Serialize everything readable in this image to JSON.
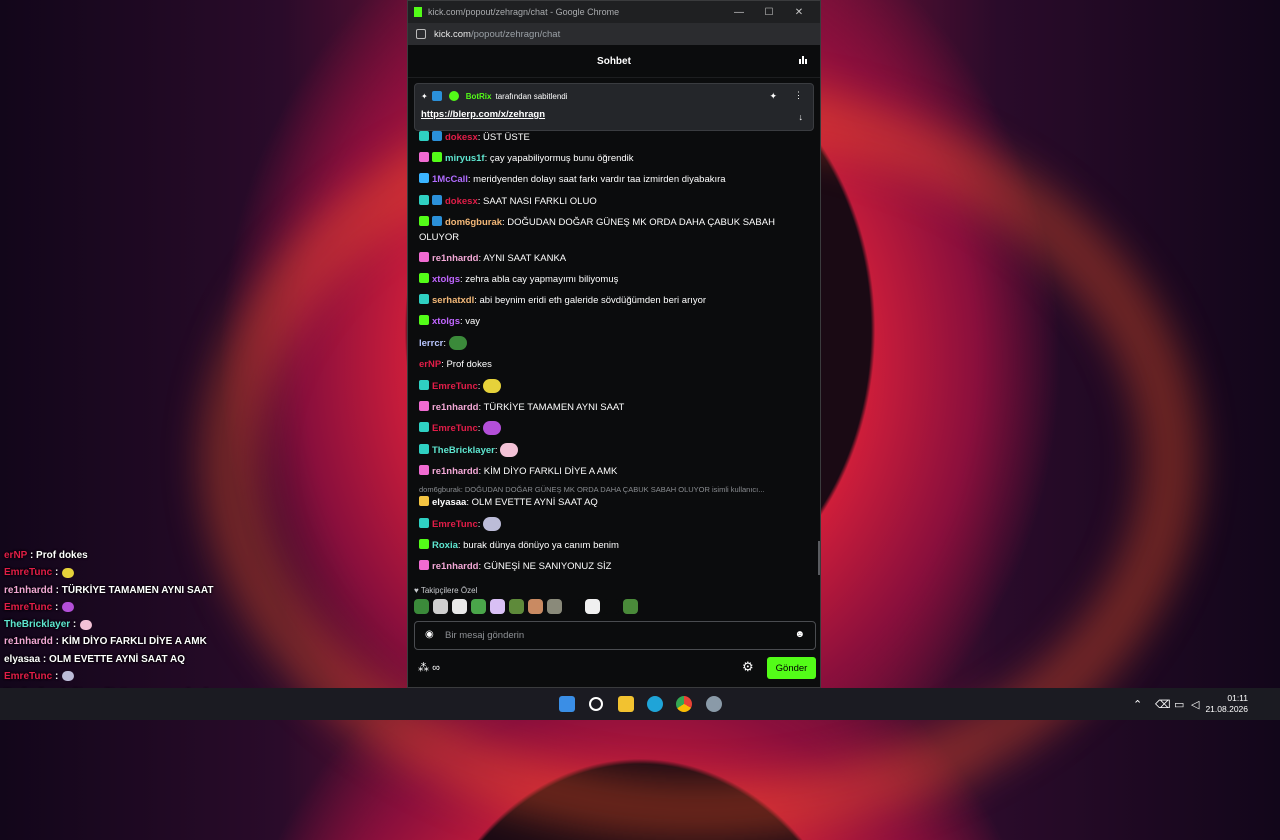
{
  "window": {
    "title": "kick.com/popout/zehragn/chat - Google Chrome",
    "url_host": "kick.com",
    "url_path": "/popout/zehragn/chat",
    "controls": [
      "—",
      "☐",
      "✕"
    ]
  },
  "chat": {
    "header": "Sohbet",
    "pinned": {
      "by_user": "BotRix",
      "by_text": "tarafından sabitlendi",
      "link": "https://blerp.com/x/zehragn"
    },
    "messages": [
      {
        "user": "dokesx",
        "color": "#e11d48",
        "text": ": ÜST ÜSTE",
        "badges": [
          "teal",
          "pick"
        ]
      },
      {
        "user": "miryus1f",
        "color": "#5ee6d0",
        "text": ": çay yapabiliyormuş bunu öğrendik",
        "badges": [
          "pink",
          "green"
        ]
      },
      {
        "user": "1McCall",
        "color": "#b06cff",
        "text": ": meridyenden dolayı saat farkı vardır taa izmirden diyabakıra",
        "badges": [
          "blue"
        ]
      },
      {
        "user": "dokesx",
        "color": "#e11d48",
        "text": ": SAAT NASI FARKLI OLUO",
        "badges": [
          "teal",
          "pick"
        ]
      },
      {
        "user": "dom6gburak",
        "color": "#f3b878",
        "text": ": DOĞUDAN DOĞAR GÜNEŞ MK ORDA DAHA ÇABUK SABAH OLUYOR",
        "badges": [
          "green",
          "pick"
        ]
      },
      {
        "user": "re1nhardd",
        "color": "#f3a8d6",
        "text": ": AYNI SAAT KANKA",
        "badges": [
          "pink"
        ]
      },
      {
        "user": "xtolgs",
        "color": "#c066ff",
        "text": ": zehra abla cay yapmayımı biliyomuş",
        "badges": [
          "green"
        ]
      },
      {
        "user": "serhatxdl",
        "color": "#f3b878",
        "text": ": abi beynim eridi eth galeride sövdüğümden beri arıyor",
        "badges": [
          "teal"
        ]
      },
      {
        "user": "xtolgs",
        "color": "#c066ff",
        "text": ": vay",
        "badges": [
          "green"
        ]
      },
      {
        "user": "lerrcr",
        "color": "#b9c6ff",
        "text": ":",
        "badges": []
      },
      {
        "user": "erNP",
        "color": "#e11d48",
        "text": ": Prof dokes",
        "badges": []
      },
      {
        "user": "EmreTunc",
        "color": "#e11d48",
        "text": ":",
        "badges": [
          "teal"
        ]
      },
      {
        "user": "re1nhardd",
        "color": "#f3a8d6",
        "text": ": TÜRKİYE TAMAMEN AYNI SAAT",
        "badges": [
          "pink"
        ]
      },
      {
        "user": "EmreTunc",
        "color": "#e11d48",
        "text": ":",
        "badges": [
          "teal"
        ]
      },
      {
        "user": "TheBricklayer",
        "color": "#5ee6d0",
        "text": ":",
        "badges": [
          "teal"
        ]
      },
      {
        "user": "re1nhardd",
        "color": "#f3a8d6",
        "text": ": KİM DİYO FARKLI DİYE A AMK",
        "badges": [
          "pink"
        ]
      },
      {
        "user": "elyasaa",
        "color": "#ffffff",
        "text": ": OLM EVETTE AYNİ SAAT AQ",
        "badges": [
          "gold"
        ]
      },
      {
        "user": "EmreTunc",
        "color": "#e11d48",
        "text": ":",
        "badges": [
          "teal"
        ]
      },
      {
        "user": "Roxia",
        "color": "#5ee6d0",
        "text": ": burak dünya dönüyo ya canım benim",
        "badges": [
          "green"
        ]
      },
      {
        "user": "re1nhardd",
        "color": "#f3a8d6",
        "text": ": GÜNEŞİ NE SANIYONUZ SİZ",
        "badges": [
          "pink"
        ]
      }
    ],
    "reply_preview": "dom6gburak: DOĞUDAN DOĞAR GÜNEŞ MK ORDA DAHA ÇABUK SABAH OLUYOR isimli kullanıcı...",
    "followers_label": "Takipçilere Özel",
    "input_placeholder": "Bir mesaj gönderin",
    "send_label": "Gönder",
    "infinity": "∞"
  },
  "overlay": [
    {
      "user": "erNP",
      "color": "#e11d48",
      "text": " : Prof dokes"
    },
    {
      "user": "EmreTunc",
      "color": "#e11d48",
      "text": " :"
    },
    {
      "user": "re1nhardd",
      "color": "#f3a8d6",
      "text": " : TÜRKİYE TAMAMEN AYNI SAAT"
    },
    {
      "user": "EmreTunc",
      "color": "#e11d48",
      "text": " :"
    },
    {
      "user": "TheBricklayer",
      "color": "#5ee6d0",
      "text": " :"
    },
    {
      "user": "re1nhardd",
      "color": "#f3a8d6",
      "text": " : KİM DİYO FARKLI DİYE A AMK"
    },
    {
      "user": "elyasaa",
      "color": "#ffffff",
      "text": " : OLM EVETTE AYNİ SAAT AQ"
    },
    {
      "user": "EmreTunc",
      "color": "#e11d48",
      "text": " :"
    },
    {
      "user": "Roxia",
      "color": "#5ee6d0",
      "text": " : burak dünya dönüyo ya canım benim"
    },
    {
      "user": "re1nhardd",
      "color": "#f3a8d6",
      "text": " : GÜNEŞİ NE SANIYONUZ SİZ"
    }
  ],
  "taskbar": {
    "time": "01:11",
    "date": "21.08.2026",
    "apps": [
      "start-icon",
      "search-icon",
      "file-explorer-icon",
      "edge-icon",
      "chrome-icon",
      "settings-icon"
    ]
  }
}
